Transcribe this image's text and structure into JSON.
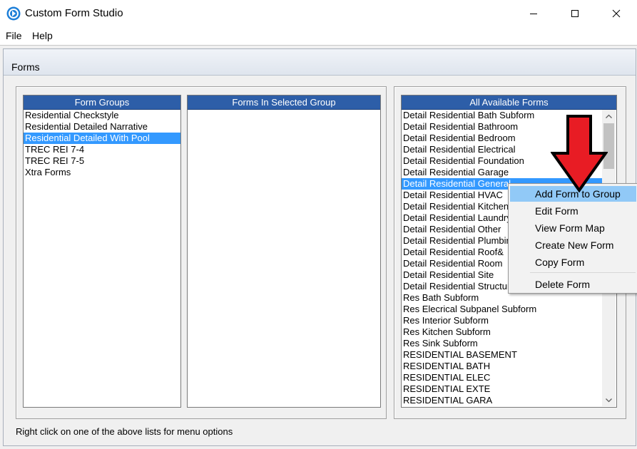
{
  "window": {
    "title": "Custom Form Studio",
    "icon": "app-logo-icon",
    "controls": [
      "minimize-icon",
      "maximize-icon",
      "close-icon"
    ]
  },
  "menubar": {
    "items": [
      "File",
      "Help"
    ]
  },
  "forms": {
    "title": "Forms",
    "form_groups": {
      "header": "Form Groups",
      "items": [
        "Residential Checkstyle",
        "Residential Detailed Narrative",
        "Residential Detailed With Pool",
        "TREC REI 7-4",
        "TREC REI 7-5",
        "Xtra Forms"
      ],
      "selected": "Residential Detailed With Pool"
    },
    "forms_in_group": {
      "header": "Forms In Selected Group",
      "items": []
    },
    "all_forms": {
      "header": "All Available Forms",
      "items": [
        "Detail Residential Bath Subform",
        "Detail Residential Bathroom",
        "Detail Residential Bedroom",
        "Detail Residential Electrical",
        "Detail Residential Foundation",
        "Detail Residential Garage",
        "Detail Residential General",
        "Detail Residential HVAC",
        "Detail Residential Kitchen",
        "Detail Residential Laundry",
        "Detail Residential Other",
        "Detail Residential Plumbing",
        "Detail Residential Roof&",
        "Detail Residential Room",
        "Detail Residential Site",
        "Detail Residential Structure",
        "Res Bath Subform",
        "Res Elecrical Subpanel Subform",
        "Res Interior Subform",
        "Res Kitchen Subform",
        "Res Sink Subform",
        "RESIDENTIAL BASEMENT",
        "RESIDENTIAL BATH",
        "RESIDENTIAL ELEC",
        "RESIDENTIAL EXTE",
        "RESIDENTIAL GARA"
      ],
      "selected": "Detail Residential General"
    }
  },
  "context_menu": {
    "items": [
      "Add Form to Group",
      "Edit Form",
      "View Form Map",
      "Create New Form",
      "Copy Form",
      "Delete Form"
    ],
    "highlighted": "Add Form to Group"
  },
  "status_text": "Right click on one of the above lists for menu options",
  "annotation": {
    "icon": "red-down-arrow-icon",
    "color": "#e81c24"
  },
  "colors": {
    "list_header": "#2d5ea8",
    "selection": "#3399ff",
    "menu_highlight": "#91c9f7",
    "app_icon": "#1e7fd8"
  }
}
